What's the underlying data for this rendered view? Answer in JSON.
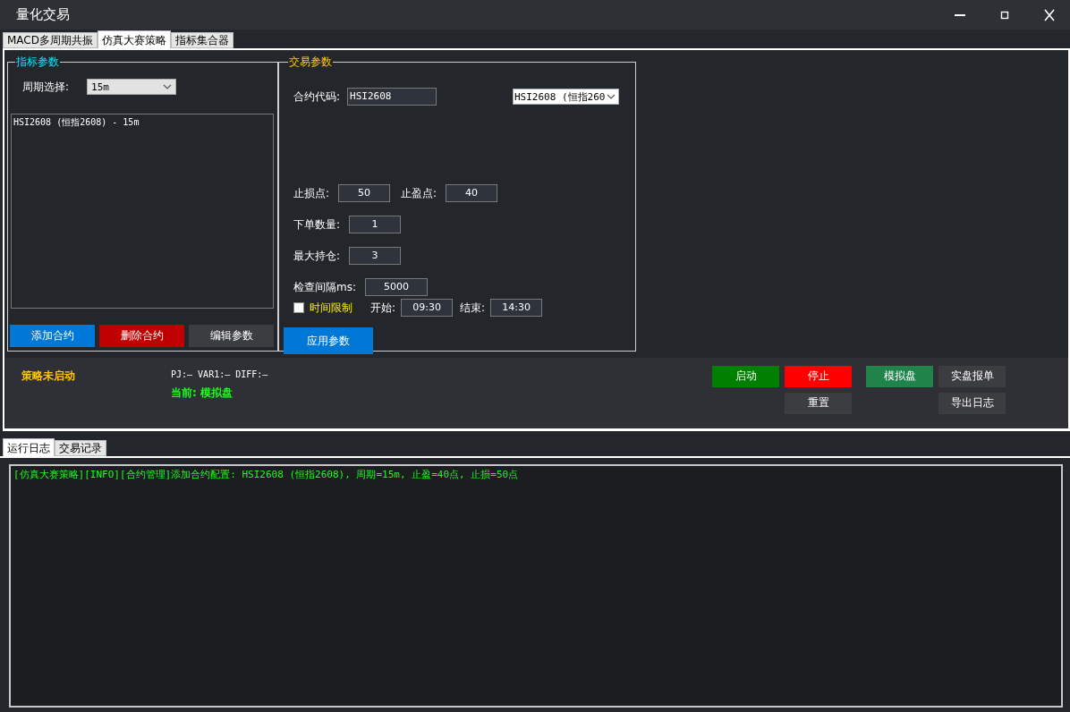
{
  "window": {
    "title": "量化交易"
  },
  "tabs": [
    {
      "label": "MACD多周期共振",
      "selected": false
    },
    {
      "label": "仿真大赛策略",
      "selected": true
    },
    {
      "label": "指标集合器",
      "selected": false
    }
  ],
  "indicator_params": {
    "title": "指标参数",
    "period_label": "周期选择:",
    "period_value": "15m",
    "contracts": [
      "HSI2608 (恒指2608) - 15m"
    ],
    "buttons": [
      {
        "label": "添加合约",
        "kind": "primary"
      },
      {
        "label": "删除合约",
        "kind": "danger"
      },
      {
        "label": "编辑参数",
        "kind": "neutral"
      }
    ]
  },
  "trade_params": {
    "title": "交易参数",
    "contract_label": "合约代码:",
    "contract_value": "HSI2608",
    "contract_combo": "HSI2608 (恒指260",
    "rows": [
      [
        {
          "label": "止损点:",
          "value": "50"
        },
        {
          "label": "止盈点:",
          "value": "40"
        }
      ],
      [
        {
          "label": "下单数量:",
          "value": "1"
        }
      ],
      [
        {
          "label": "最大持仓:",
          "value": "3"
        }
      ],
      [
        {
          "label": "检查间隔ms:",
          "value": "5000"
        }
      ]
    ],
    "time_limit": {
      "label": "时间限制",
      "checked": false
    },
    "start_label": "开始:",
    "start_value": "09:30",
    "end_label": "结束:",
    "end_value": "14:30",
    "apply_button": "应用参数"
  },
  "status": {
    "state": "策略未启动",
    "values": "PJ:— VAR1:— DIFF:—",
    "current": "当前: 模拟盘",
    "buttons": [
      {
        "label": "启动",
        "kind": "start"
      },
      {
        "label": "停止",
        "kind": "stop"
      },
      {
        "label": "模拟盘",
        "kind": "mode",
        "selected": true
      },
      {
        "label": "实盘报单",
        "kind": "mode",
        "selected": false
      },
      {
        "label": "重置",
        "kind": "neutral"
      },
      {
        "label": "导出日志",
        "kind": "neutral"
      }
    ]
  },
  "log_tabs": [
    {
      "label": "运行日志",
      "selected": true
    },
    {
      "label": "交易记录",
      "selected": false
    }
  ],
  "log_lines": [
    "[仿真大赛策略][INFO][合约管理]添加合约配置: HSI2608 (恒指2608), 周期=15m, 止盈=40点, 止损=50点"
  ]
}
